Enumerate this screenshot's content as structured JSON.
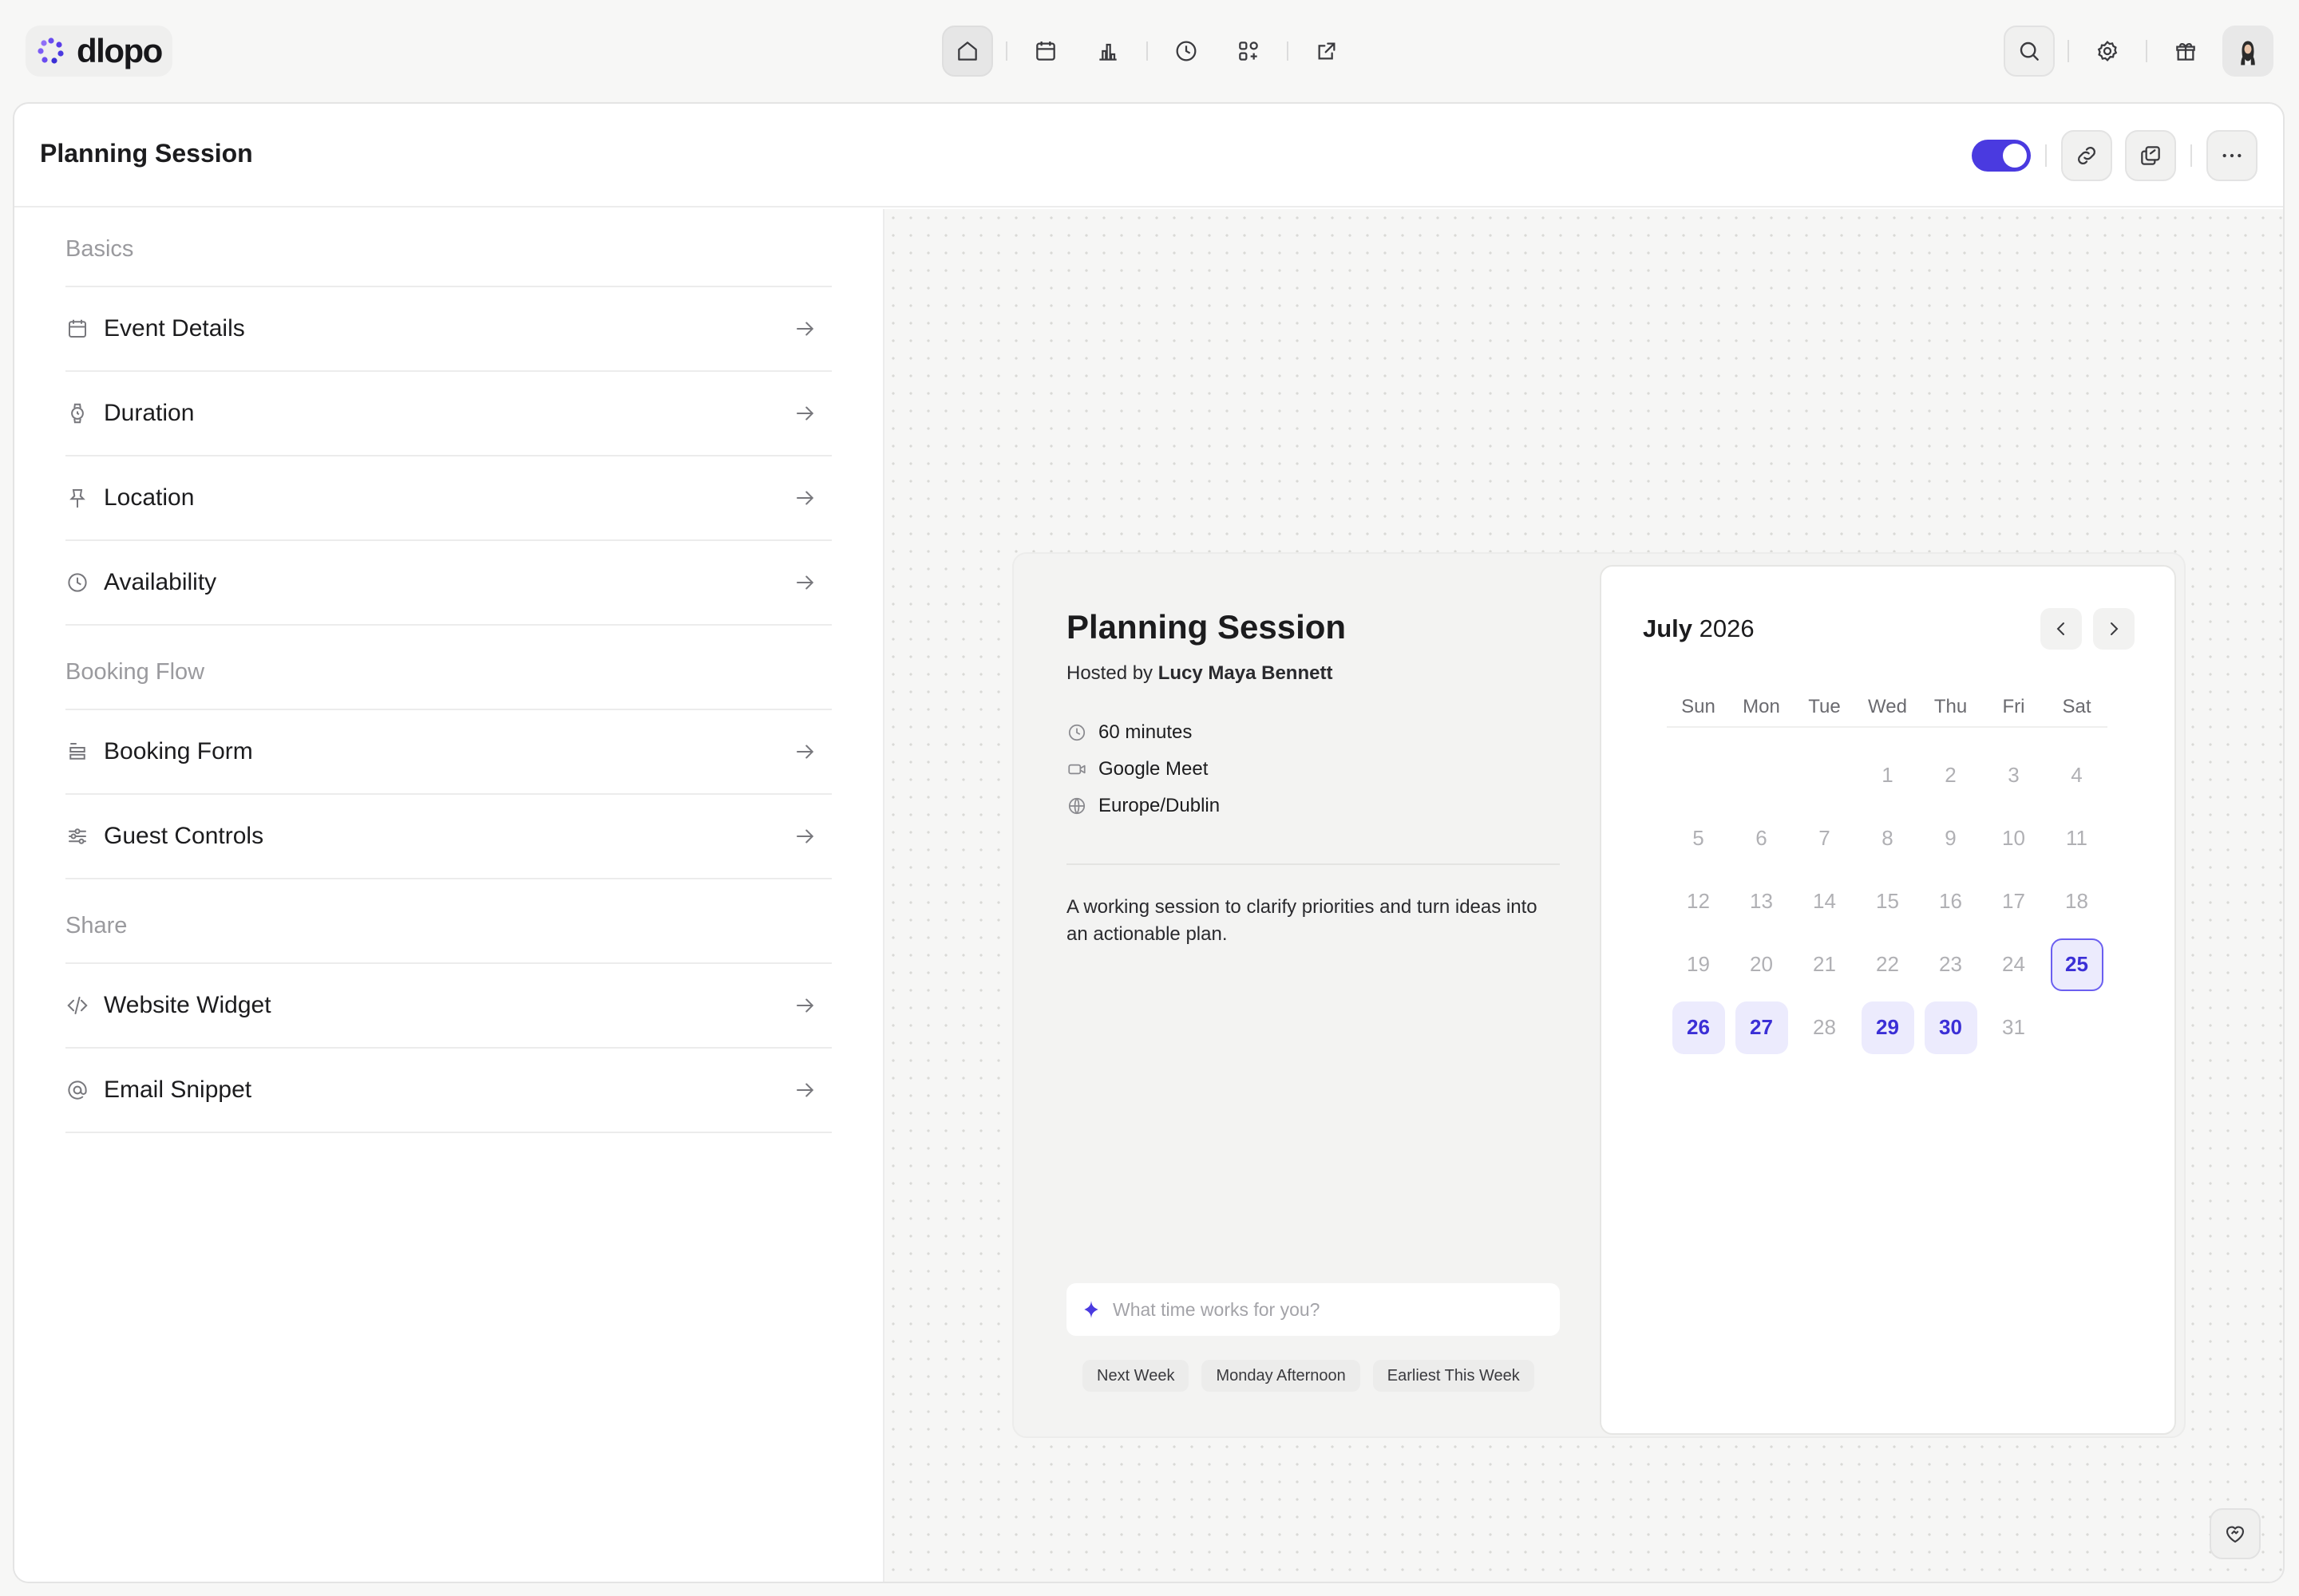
{
  "app": {
    "name": "dlopo",
    "accent_color": "#4a3ae0"
  },
  "topnav": {
    "items": [
      {
        "icon": "home-icon",
        "active": true
      },
      {
        "icon": "calendar-icon",
        "active": false
      },
      {
        "icon": "bar-chart-icon",
        "active": false
      },
      {
        "icon": "clock-icon",
        "active": false
      },
      {
        "icon": "apps-icon",
        "active": false
      },
      {
        "icon": "external-link-icon",
        "active": false
      }
    ],
    "right": [
      "search-icon",
      "gear-icon",
      "gift-icon",
      "avatar"
    ]
  },
  "page": {
    "title": "Planning Session",
    "enabled": true
  },
  "sidebar": {
    "sections": [
      {
        "label": "Basics",
        "items": [
          {
            "label": "Event Details",
            "icon": "calendar-icon"
          },
          {
            "label": "Duration",
            "icon": "watch-icon"
          },
          {
            "label": "Location",
            "icon": "pin-icon"
          },
          {
            "label": "Availability",
            "icon": "clock-icon"
          }
        ]
      },
      {
        "label": "Booking Flow",
        "items": [
          {
            "label": "Booking Form",
            "icon": "form-icon"
          },
          {
            "label": "Guest Controls",
            "icon": "sliders-icon"
          }
        ]
      },
      {
        "label": "Share",
        "items": [
          {
            "label": "Website Widget",
            "icon": "code-icon"
          },
          {
            "label": "Email Snippet",
            "icon": "at-icon"
          }
        ]
      }
    ]
  },
  "preview": {
    "title": "Planning Session",
    "hosted_prefix": "Hosted by",
    "host": "Lucy Maya Bennett",
    "duration": "60 minutes",
    "location": "Google Meet",
    "timezone": "Europe/Dublin",
    "description": "A working session to clarify priorities and turn ideas into an actionable plan.",
    "ask_placeholder": "What time works for you?",
    "chips": [
      "Next Week",
      "Monday Afternoon",
      "Earliest This Week"
    ]
  },
  "calendar": {
    "month": "July",
    "year": "2026",
    "weekdays": [
      "Sun",
      "Mon",
      "Tue",
      "Wed",
      "Thu",
      "Fri",
      "Sat"
    ],
    "first_weekday_index": 3,
    "days_in_month": 31,
    "today": 25,
    "available": [
      25,
      26,
      27,
      29,
      30
    ]
  }
}
